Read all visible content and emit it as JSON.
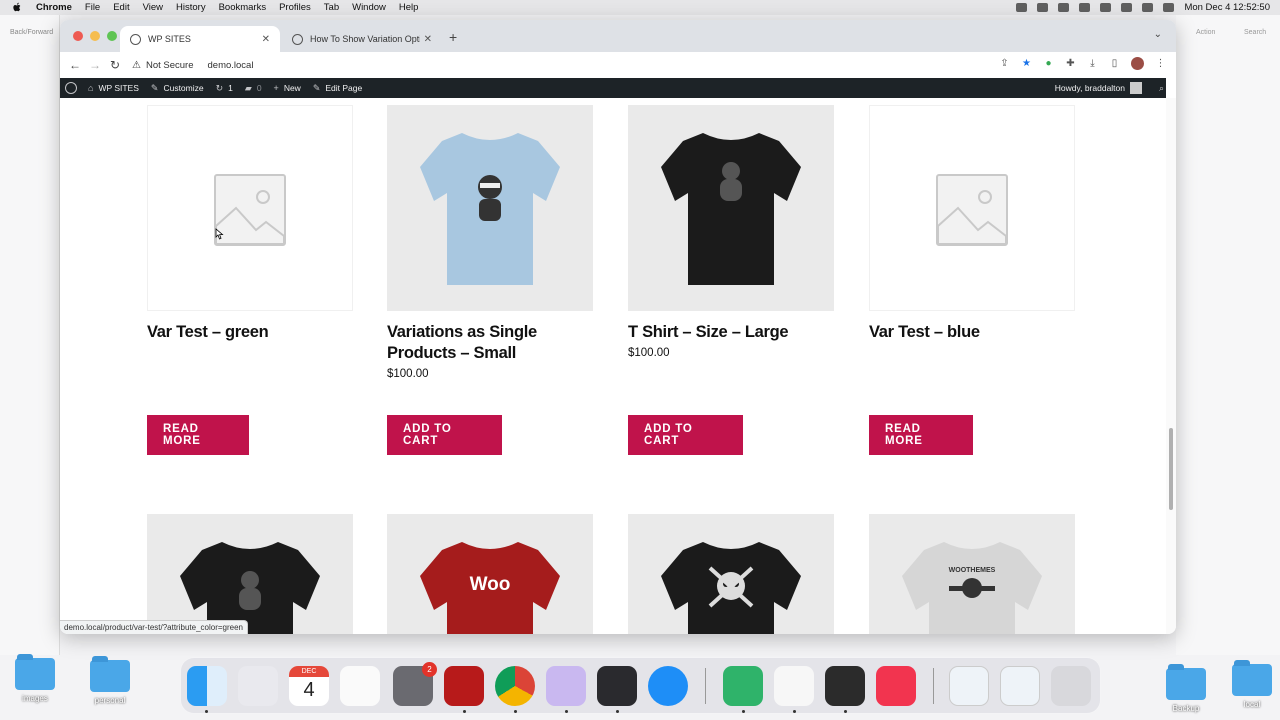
{
  "menubar": {
    "app": "Chrome",
    "items": [
      "File",
      "Edit",
      "View",
      "History",
      "Bookmarks",
      "Profiles",
      "Tab",
      "Window",
      "Help"
    ],
    "clock": "Mon Dec 4  12:52:50"
  },
  "background_app": {
    "left_label": "Back/Forward",
    "right_labels": [
      "Action",
      "Search"
    ]
  },
  "browser": {
    "tabs": [
      {
        "title": "WP SITES",
        "active": true
      },
      {
        "title": "How To Show Variation Option",
        "active": false
      }
    ],
    "security": "Not Secure",
    "url": "demo.local",
    "status_url": "demo.local/product/var-test/?attribute_color=green"
  },
  "adminbar": {
    "site": "WP SITES",
    "customize": "Customize",
    "updates": "1",
    "comments": "0",
    "new": "New",
    "edit": "Edit Page",
    "howdy": "Howdy, braddalton"
  },
  "products": [
    {
      "title": "Var Test – green",
      "price": "",
      "button": "READ MORE",
      "image": "placeholder"
    },
    {
      "title": "Variations as Single Products – Small",
      "price": "$100.00",
      "button": "ADD TO CART",
      "image": "light-blue-ninja-tshirt"
    },
    {
      "title": "T Shirt – Size – Large",
      "price": "$100.00",
      "button": "ADD TO CART",
      "image": "black-tshirt"
    },
    {
      "title": "Var Test – blue",
      "price": "",
      "button": "READ MORE",
      "image": "placeholder"
    }
  ],
  "row2_images": [
    "black-tshirt",
    "red-woo-tshirt",
    "black-skull-tshirt",
    "white-woothemes-tshirt"
  ],
  "row2_text": {
    "woo": "Woo",
    "woothemes": "WOOTHEMES"
  },
  "calendar": {
    "month": "DEC",
    "day": "4"
  },
  "dock_badge": "2",
  "desktop_folders": [
    "images",
    "personal",
    "Backup",
    "local"
  ],
  "colors": {
    "button": "#c0134b",
    "adminbar": "#1d2327"
  }
}
